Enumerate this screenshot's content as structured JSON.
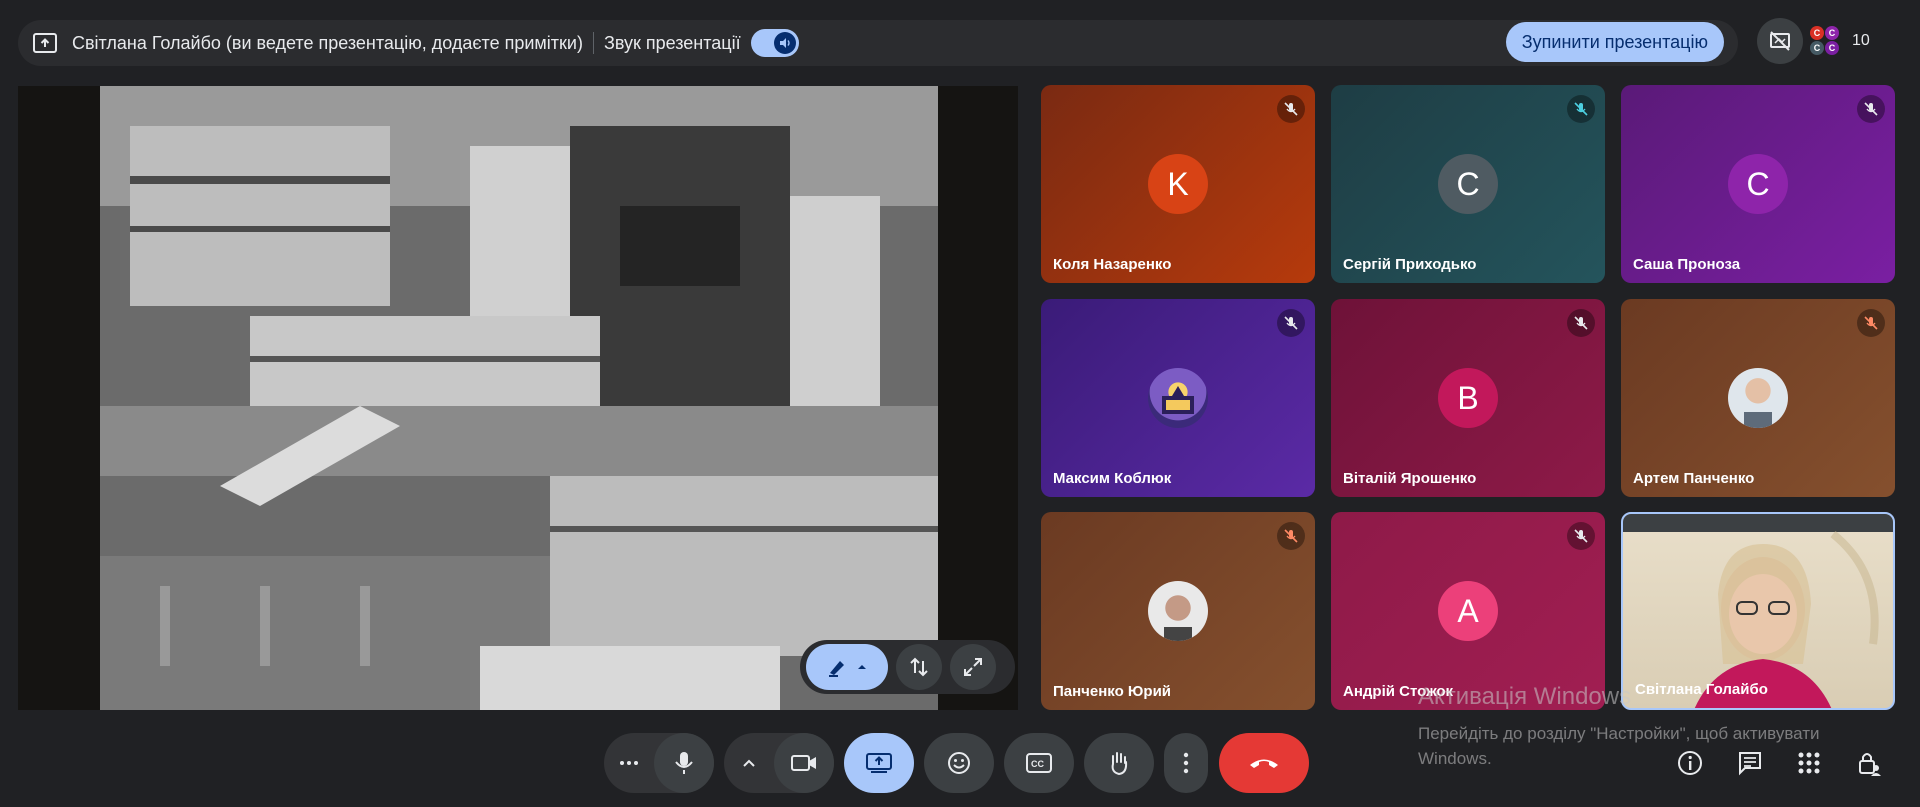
{
  "topbar": {
    "presenter_title": "Світлана Голайбо (ви ведете презентацію, додаєте примітки)",
    "audio_label": "Звук презентації",
    "stop_button": "Зупинити презентацію"
  },
  "participants": {
    "count": "10",
    "avatar_letters": [
      "С",
      "С",
      "С",
      "С"
    ]
  },
  "tiles": [
    {
      "name": "Коля Назаренко",
      "initial": "K"
    },
    {
      "name": "Сергій Приходько",
      "initial": "C"
    },
    {
      "name": "Саша Проноза",
      "initial": "C"
    },
    {
      "name": "Максим Коблюк",
      "initial": ""
    },
    {
      "name": "Віталій Ярошенко",
      "initial": "B"
    },
    {
      "name": "Артем Панченко",
      "initial": ""
    },
    {
      "name": "Панченко Юрий",
      "initial": ""
    },
    {
      "name": "Андрій Стожок",
      "initial": "A"
    },
    {
      "name": "Світлана Голайбо",
      "initial": ""
    }
  ],
  "watermark": {
    "title": "Активація Windows",
    "line1": "Перейдіть до розділу \"Настройки\", щоб активувати",
    "line2": "Windows."
  },
  "colors": {
    "accent": "#a8c7fa",
    "end_call": "#e53935",
    "background": "#202124"
  }
}
